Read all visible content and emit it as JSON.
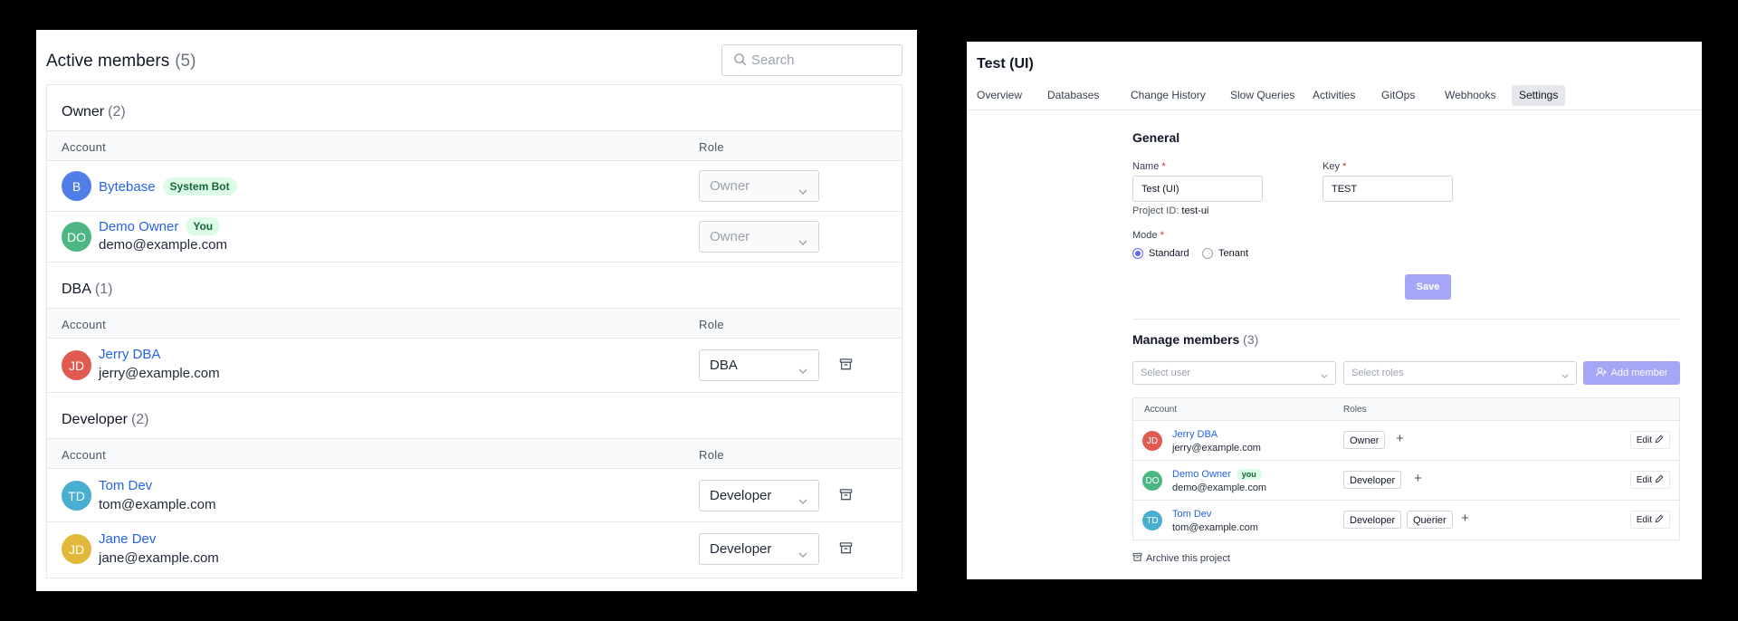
{
  "members_panel": {
    "title": "Active members",
    "count": "(5)",
    "search_placeholder": "Search",
    "col_account": "Account",
    "col_role": "Role",
    "groups": [
      {
        "title": "Owner",
        "count": "(2)",
        "members": [
          {
            "initials": "B",
            "name": "Bytebase",
            "badge": "System Bot",
            "email": "",
            "role": "Owner",
            "avatar_color": "#4f7fe6"
          },
          {
            "initials": "DO",
            "name": "Demo Owner",
            "badge": "You",
            "email": "demo@example.com",
            "role": "Owner",
            "avatar_color": "#4cb782"
          }
        ]
      },
      {
        "title": "DBA",
        "count": "(1)",
        "members": [
          {
            "initials": "JD",
            "name": "Jerry DBA",
            "email": "jerry@example.com",
            "role": "DBA",
            "avatar_color": "#e05a52"
          }
        ]
      },
      {
        "title": "Developer",
        "count": "(2)",
        "members": [
          {
            "initials": "TD",
            "name": "Tom Dev",
            "email": "tom@example.com",
            "role": "Developer",
            "avatar_color": "#48afd0"
          },
          {
            "initials": "JD",
            "name": "Jane Dev",
            "email": "jane@example.com",
            "role": "Developer",
            "avatar_color": "#e2b83a"
          }
        ]
      }
    ]
  },
  "project_panel": {
    "title": "Test (UI)",
    "tabs": [
      "Overview",
      "Databases",
      "Change History",
      "Slow Queries",
      "Activities",
      "GitOps",
      "Webhooks",
      "Settings"
    ],
    "active_tab": "Settings",
    "general": {
      "title": "General",
      "name_label": "Name",
      "name_value": "Test (UI)",
      "key_label": "Key",
      "key_value": "TEST",
      "project_id_label": "Project ID:",
      "project_id_value": "test-ui",
      "mode_label": "Mode",
      "mode_standard": "Standard",
      "mode_tenant": "Tenant",
      "save_label": "Save"
    },
    "manage": {
      "title": "Manage members",
      "count": "(3)",
      "select_user_placeholder": "Select user",
      "select_roles_placeholder": "Select roles",
      "add_member_label": "Add member",
      "col_account": "Account",
      "col_roles": "Roles",
      "edit_label": "Edit",
      "rows": [
        {
          "initials": "JD",
          "name": "Jerry DBA",
          "email": "jerry@example.com",
          "badge": "",
          "roles": [
            "Owner"
          ],
          "avatar_color": "#e05a52"
        },
        {
          "initials": "DO",
          "name": "Demo Owner",
          "email": "demo@example.com",
          "badge": "you",
          "roles": [
            "Developer"
          ],
          "avatar_color": "#4cb782"
        },
        {
          "initials": "TD",
          "name": "Tom Dev",
          "email": "tom@example.com",
          "badge": "",
          "roles": [
            "Developer",
            "Querier"
          ],
          "avatar_color": "#48afd0"
        }
      ]
    },
    "archive_label": "Archive this project"
  }
}
